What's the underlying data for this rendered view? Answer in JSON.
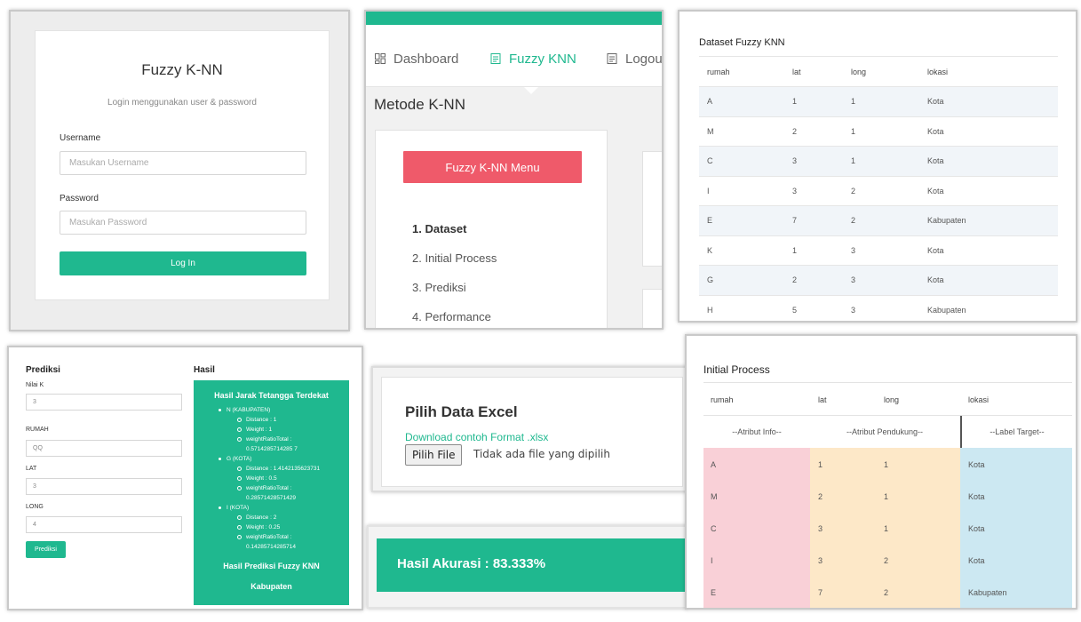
{
  "login": {
    "title": "Fuzzy K-NN",
    "subtitle": "Login menggunakan user & password",
    "username_label": "Username",
    "username_placeholder": "Masukan Username",
    "password_label": "Password",
    "password_placeholder": "Masukan Password",
    "login_button": "Log In"
  },
  "menu": {
    "nav": [
      {
        "label": "Dashboard",
        "icon": "dashboard-icon"
      },
      {
        "label": "Fuzzy KNN",
        "icon": "document-icon"
      },
      {
        "label": "Logout",
        "icon": "document-icon"
      }
    ],
    "heading": "Metode K-NN",
    "menu_button": "Fuzzy K-NN Menu",
    "steps": [
      "1. Dataset",
      "2. Initial Process",
      "3. Prediksi",
      "4. Performance"
    ]
  },
  "dataset": {
    "title": "Dataset Fuzzy KNN",
    "columns": [
      "rumah",
      "lat",
      "long",
      "lokasi"
    ],
    "rows": [
      [
        "A",
        "1",
        "1",
        "Kota"
      ],
      [
        "M",
        "2",
        "1",
        "Kota"
      ],
      [
        "C",
        "3",
        "1",
        "Kota"
      ],
      [
        "I",
        "3",
        "2",
        "Kota"
      ],
      [
        "E",
        "7",
        "2",
        "Kabupaten"
      ],
      [
        "K",
        "1",
        "3",
        "Kota"
      ],
      [
        "G",
        "2",
        "3",
        "Kota"
      ],
      [
        "H",
        "5",
        "3",
        "Kabupaten"
      ]
    ]
  },
  "prediksi": {
    "heading": "Prediksi",
    "fields": [
      {
        "label": "Nilai K",
        "value": "3"
      },
      {
        "label": "RUMAH",
        "value": "QQ"
      },
      {
        "label": "LAT",
        "value": "3"
      },
      {
        "label": "LONG",
        "value": "4"
      }
    ],
    "button": "Prediksi",
    "hasil_heading": "Hasil",
    "hasil_title": "Hasil Jarak Tetangga Terdekat",
    "neighbors": [
      {
        "name": "N (KABUPATEN)",
        "distance": "Distance : 1",
        "weight": "Weight : 1",
        "ratio_label": "weightRatioTotal :",
        "ratio_value": "0.5714285714285 7"
      },
      {
        "name": "G (KOTA)",
        "distance": "Distance : 1.4142135623731",
        "weight": "Weight : 0.5",
        "ratio_label": "weightRatioTotal :",
        "ratio_value": "0.28571428571429"
      },
      {
        "name": "I (KOTA)",
        "distance": "Distance : 2",
        "weight": "Weight : 0.25",
        "ratio_label": "weightRatioTotal :",
        "ratio_value": "0.14285714285714"
      }
    ],
    "result_title": "Hasil Prediksi Fuzzy KNN",
    "result_value": "Kabupaten"
  },
  "excel": {
    "title": "Pilih Data Excel",
    "link": "Download contoh Format .xlsx",
    "file_button": "Pilih File",
    "file_status": "Tidak ada file yang dipilih"
  },
  "akurasi": {
    "text": "Hasil Akurasi : 83.333%"
  },
  "initial": {
    "title": "Initial Process",
    "columns": [
      "rumah",
      "lat",
      "long",
      "lokasi"
    ],
    "groups": [
      "--Atribut Info--",
      "--Atribut Pendukung--",
      "--Label Target--"
    ],
    "rows": [
      [
        "A",
        "1",
        "1",
        "Kota"
      ],
      [
        "M",
        "2",
        "1",
        "Kota"
      ],
      [
        "C",
        "3",
        "1",
        "Kota"
      ],
      [
        "I",
        "3",
        "2",
        "Kota"
      ],
      [
        "E",
        "7",
        "2",
        "Kabupaten"
      ]
    ],
    "colors": {
      "info": "#f9d0d7",
      "pendukung": "#fde8c8",
      "target": "#cce8f2"
    }
  },
  "colors": {
    "accent": "#1fb88f",
    "danger": "#ef5a6a"
  }
}
